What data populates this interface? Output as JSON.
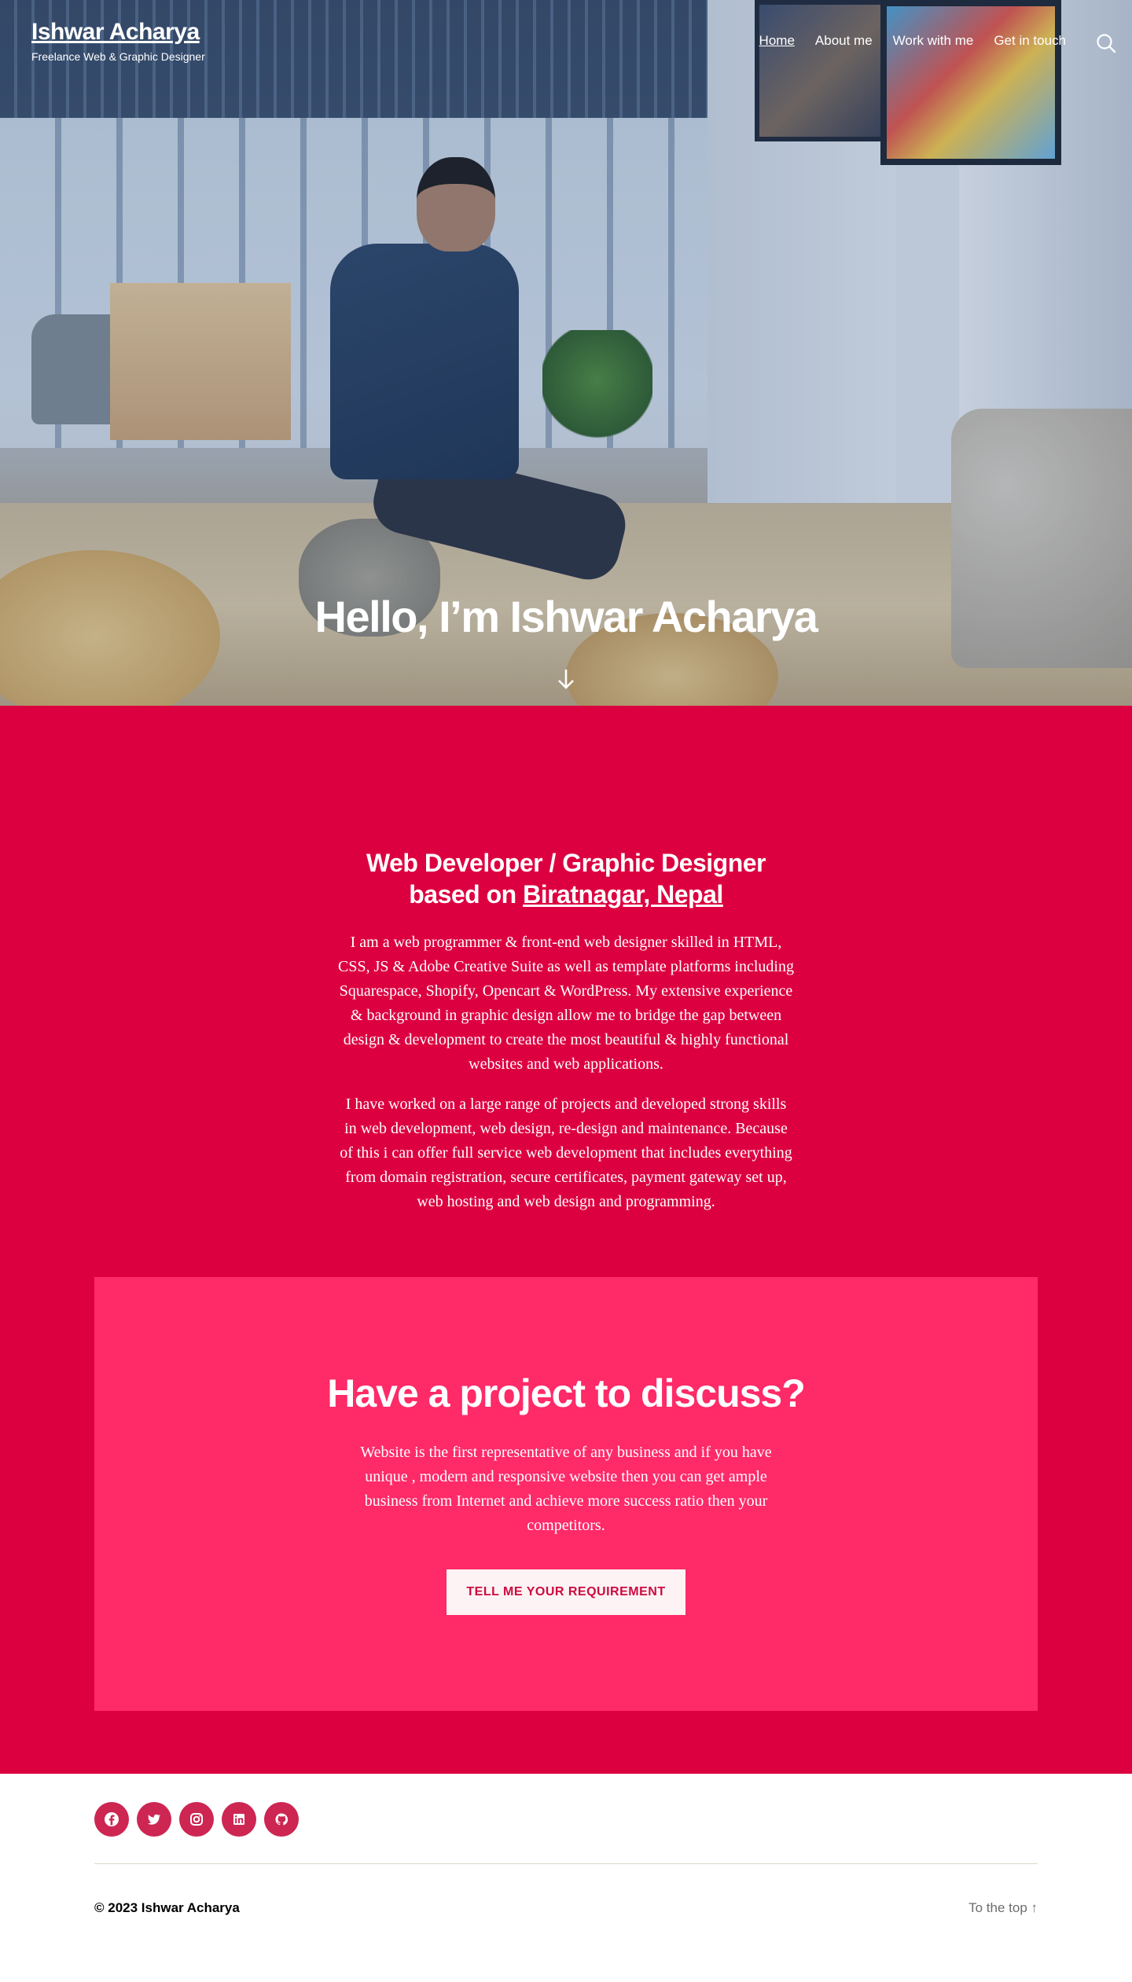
{
  "header": {
    "site_title": "Ishwar Acharya",
    "tagline": "Freelance Web & Graphic Designer",
    "nav": [
      {
        "label": "Home"
      },
      {
        "label": "About me"
      },
      {
        "label": "Work with me"
      },
      {
        "label": "Get in touch"
      }
    ],
    "search_icon": "search-icon"
  },
  "hero": {
    "title": "Hello, I’m Ishwar Acharya",
    "scroll_icon": "arrow-down-icon"
  },
  "intro": {
    "heading_prefix": "Web Developer / Graphic Designer based on",
    "heading_link": "Biratnagar, Nepal",
    "paragraph1": "I am a web programmer & front-end web designer skilled in HTML, CSS, JS & Adobe Creative Suite as well as template platforms including Squarespace, Shopify, Opencart & WordPress. My extensive experience & background in graphic design allow me to bridge the gap between design & development to create the most beautiful & highly functional websites and web applications.",
    "paragraph2": "I have worked on a large range of projects and developed strong skills in web development, web design, re-design and maintenance. Because of this i can offer full service web development that includes everything from domain registration, secure certificates, payment gateway set up, web hosting and web design and programming."
  },
  "cta": {
    "title": "Have a project to discuss?",
    "text": "Website is the first representative of any business and if you have unique , modern and responsive website then you can get ample business from Internet and achieve more success ratio then your competitors.",
    "button_label": "TELL ME YOUR REQUIREMENT"
  },
  "footer": {
    "social_icons": [
      "facebook-icon",
      "twitter-icon",
      "instagram-icon",
      "linkedin-icon",
      "github-icon"
    ],
    "copyright": "© 2023 Ishwar Acharya",
    "to_top": "To the top ↑"
  },
  "colors": {
    "primary_section": "#dd0040",
    "cta_box": "#ff2a68",
    "social_icon_bg": "#cd2653",
    "button_text": "#cc0a3e"
  }
}
